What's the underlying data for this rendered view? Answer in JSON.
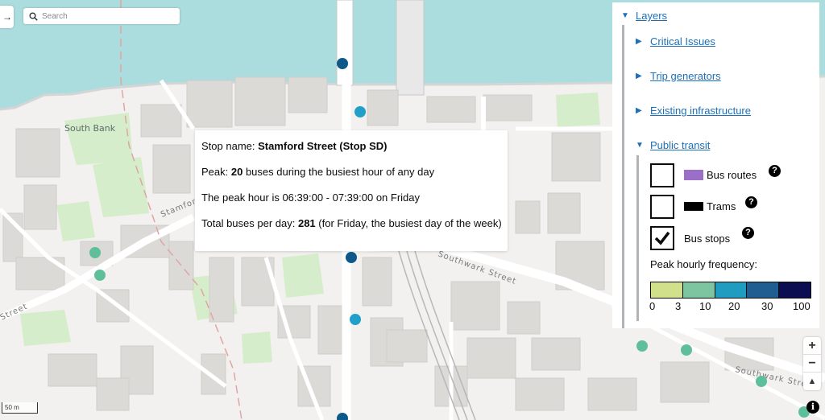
{
  "search": {
    "placeholder": "Search"
  },
  "map": {
    "place_labels": [
      "South Bank"
    ],
    "street_labels": [
      "Stamford",
      "Southwark Street",
      "Southwark Street",
      "Street"
    ],
    "stop_colors": {
      "light": "#5fbf9a",
      "medium": "#20a0c8",
      "dark": "#0d5a8a"
    }
  },
  "popup": {
    "stop_prefix": "Stop name: ",
    "stop_name": "Stamford Street (Stop SD)",
    "peak_prefix": "Peak: ",
    "peak_value": "20",
    "peak_suffix": " buses during the busiest hour of any day",
    "peak_hour": "The peak hour is 06:39:00 - 07:39:00 on Friday",
    "total_prefix": "Total buses per day: ",
    "total_value": "281",
    "total_suffix": " (for Friday, the busiest day of the week)"
  },
  "layers": {
    "title": "Layers",
    "groups": [
      {
        "label": "Critical Issues",
        "expanded": false
      },
      {
        "label": "Trip generators",
        "expanded": false
      },
      {
        "label": "Existing infrastructure",
        "expanded": false
      },
      {
        "label": "Public transit",
        "expanded": true
      }
    ],
    "public_transit": [
      {
        "label": "Bus routes",
        "checked": false,
        "swatch": "#9b6fc8"
      },
      {
        "label": "Trams",
        "checked": false,
        "swatch": "#000000"
      },
      {
        "label": "Bus stops",
        "checked": true
      }
    ],
    "help_symbol": "?",
    "legend": {
      "title": "Peak hourly frequency:",
      "colors": [
        "#d1e08a",
        "#7cc5a0",
        "#1f9cc0",
        "#205e91",
        "#0b0f52"
      ],
      "ticks": [
        "0",
        "3",
        "10",
        "20",
        "30",
        "100"
      ]
    }
  },
  "controls": {
    "zoom_in": "+",
    "zoom_out": "−",
    "reset_north": "▲",
    "collapse_arrow": "→",
    "info": "i"
  },
  "scale_label": "50 m"
}
